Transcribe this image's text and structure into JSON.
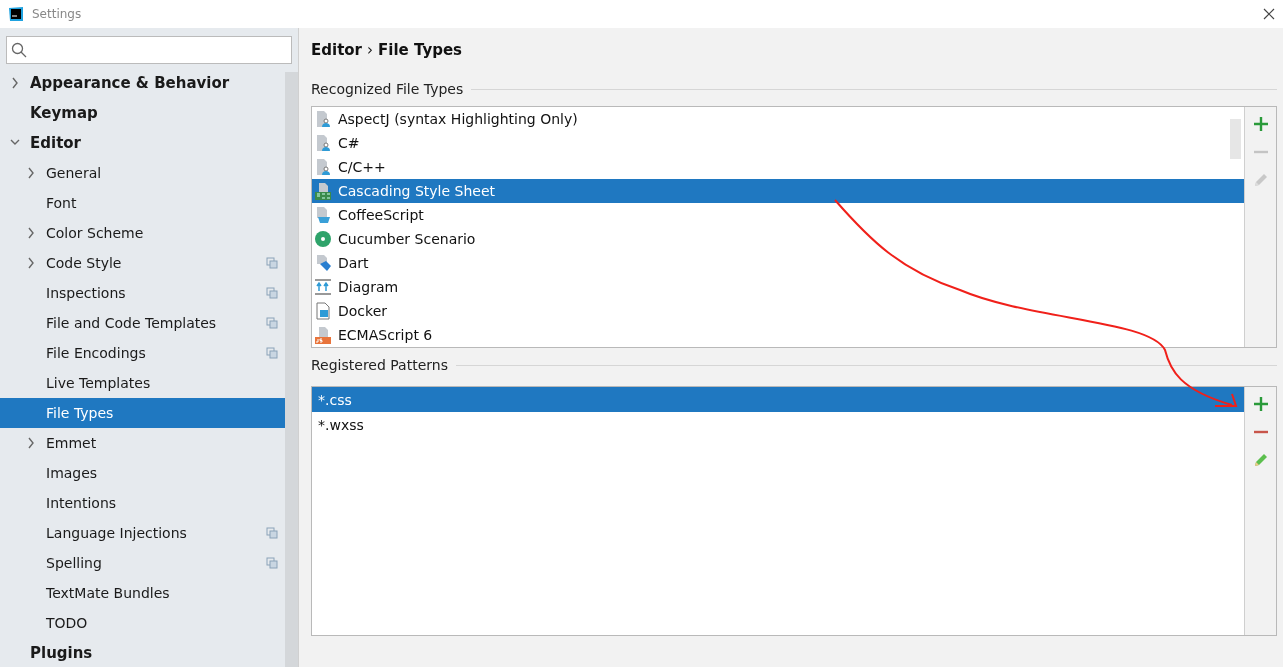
{
  "window": {
    "title": "Settings"
  },
  "sidebar": {
    "items": [
      {
        "label": "Appearance & Behavior",
        "expanded": false,
        "selected": false
      },
      {
        "label": "Keymap",
        "selected": false
      },
      {
        "label": "Editor",
        "expanded": true,
        "selected": false,
        "children": [
          {
            "label": "General",
            "expanded": false,
            "selected": false
          },
          {
            "label": "Font",
            "selected": false
          },
          {
            "label": "Color Scheme",
            "expanded": false,
            "selected": false
          },
          {
            "label": "Code Style",
            "expanded": false,
            "selected": false,
            "badge": true
          },
          {
            "label": "Inspections",
            "selected": false,
            "badge": true
          },
          {
            "label": "File and Code Templates",
            "selected": false,
            "badge": true
          },
          {
            "label": "File Encodings",
            "selected": false,
            "badge": true
          },
          {
            "label": "Live Templates",
            "selected": false
          },
          {
            "label": "File Types",
            "selected": true
          },
          {
            "label": "Emmet",
            "expanded": false,
            "selected": false
          },
          {
            "label": "Images",
            "selected": false
          },
          {
            "label": "Intentions",
            "selected": false
          },
          {
            "label": "Language Injections",
            "selected": false,
            "badge": true
          },
          {
            "label": "Spelling",
            "selected": false,
            "badge": true
          },
          {
            "label": "TextMate Bundles",
            "selected": false
          },
          {
            "label": "TODO",
            "selected": false
          }
        ]
      },
      {
        "label": "Plugins",
        "selected": false
      }
    ]
  },
  "breadcrumb": {
    "parent": "Editor",
    "separator": "›",
    "current": "File Types"
  },
  "recognized": {
    "title": "Recognized File Types",
    "items": [
      {
        "label": "AspectJ (syntax Highlighting Only)",
        "kind": "generic",
        "selected": false
      },
      {
        "label": "C#",
        "kind": "generic",
        "selected": false
      },
      {
        "label": "C/C++",
        "kind": "generic",
        "selected": false
      },
      {
        "label": "Cascading Style Sheet",
        "kind": "css",
        "selected": true
      },
      {
        "label": "CoffeeScript",
        "kind": "coffee",
        "selected": false
      },
      {
        "label": "Cucumber Scenario",
        "kind": "cucumber",
        "selected": false
      },
      {
        "label": "Dart",
        "kind": "dart",
        "selected": false
      },
      {
        "label": "Diagram",
        "kind": "diagram",
        "selected": false
      },
      {
        "label": "Docker",
        "kind": "docker",
        "selected": false
      },
      {
        "label": "ECMAScript 6",
        "kind": "js",
        "selected": false
      }
    ],
    "tools": [
      {
        "kind": "add",
        "disabled": false
      },
      {
        "kind": "remove",
        "disabled": true
      },
      {
        "kind": "edit",
        "disabled": true
      }
    ]
  },
  "patterns": {
    "title": "Registered Patterns",
    "items": [
      {
        "label": "*.css",
        "selected": true
      },
      {
        "label": "*.wxss",
        "selected": false
      }
    ],
    "tools": [
      {
        "kind": "add",
        "disabled": false
      },
      {
        "kind": "remove",
        "disabled": false
      },
      {
        "kind": "edit",
        "disabled": false
      }
    ]
  },
  "annotation": {
    "visible": true
  }
}
